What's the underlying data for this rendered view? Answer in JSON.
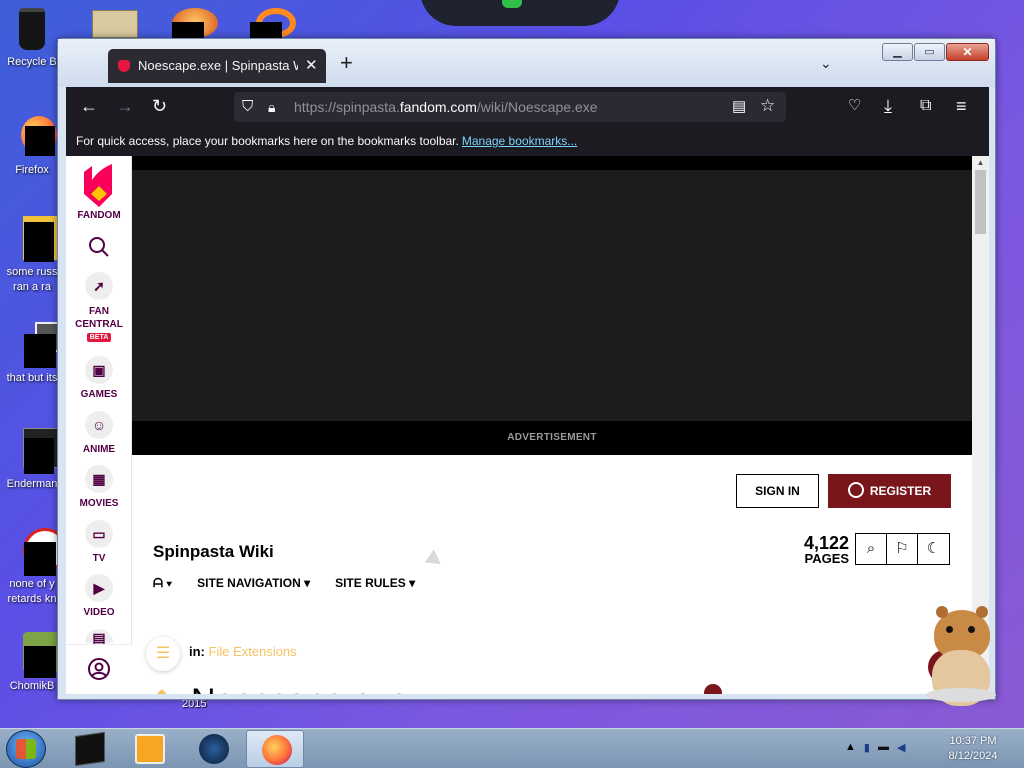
{
  "desktop": {
    "icons": [
      {
        "label": "Recycle B"
      },
      {
        "label": "Firefox"
      },
      {
        "label": "some russ\nran a ra"
      },
      {
        "label": "that but its"
      },
      {
        "label": "Enderman"
      },
      {
        "label": "none of y\nretards kn"
      },
      {
        "label": "ChomikB"
      }
    ],
    "year_label": "2015"
  },
  "browser": {
    "tab_title": "Noescape.exe | Spinpasta Wiki |",
    "tab_close": "✕",
    "new_tab": "+",
    "tab_list": "⌄",
    "url_prefix": "https://spinpasta.",
    "url_domain": "fandom.com",
    "url_path": "/wiki/Noescape.exe",
    "bookmarks_text": "For quick access, place your bookmarks here on the bookmarks toolbar.",
    "bookmarks_link": "Manage bookmarks..."
  },
  "fandom": {
    "logo_label": "FANDOM",
    "rail": [
      {
        "label": "FAN\nCENTRAL"
      },
      {
        "label": "GAMES"
      },
      {
        "label": "ANIME"
      },
      {
        "label": "MOVIES"
      },
      {
        "label": "TV"
      },
      {
        "label": "VIDEO"
      }
    ],
    "beta": "BETA",
    "advertisement": "ADVERTISEMENT",
    "sign_in": "SIGN IN",
    "register": "REGISTER",
    "wiki_title": "Spinpasta Wiki",
    "pages_count": "4,122",
    "pages_label": "PAGES",
    "nav": [
      "SITE NAVIGATION",
      "SITE RULES"
    ],
    "breadcrumb_prefix": "in:",
    "breadcrumb_category": "File Extensions",
    "page_title": "Noescape.exe"
  },
  "taskbar": {
    "time": "10:37 PM",
    "date": "8/12/2024"
  },
  "colors": {
    "fandom_red": "#79161b",
    "fandom_link": "#f4c25e",
    "browser_dark": "#1c1b22"
  }
}
